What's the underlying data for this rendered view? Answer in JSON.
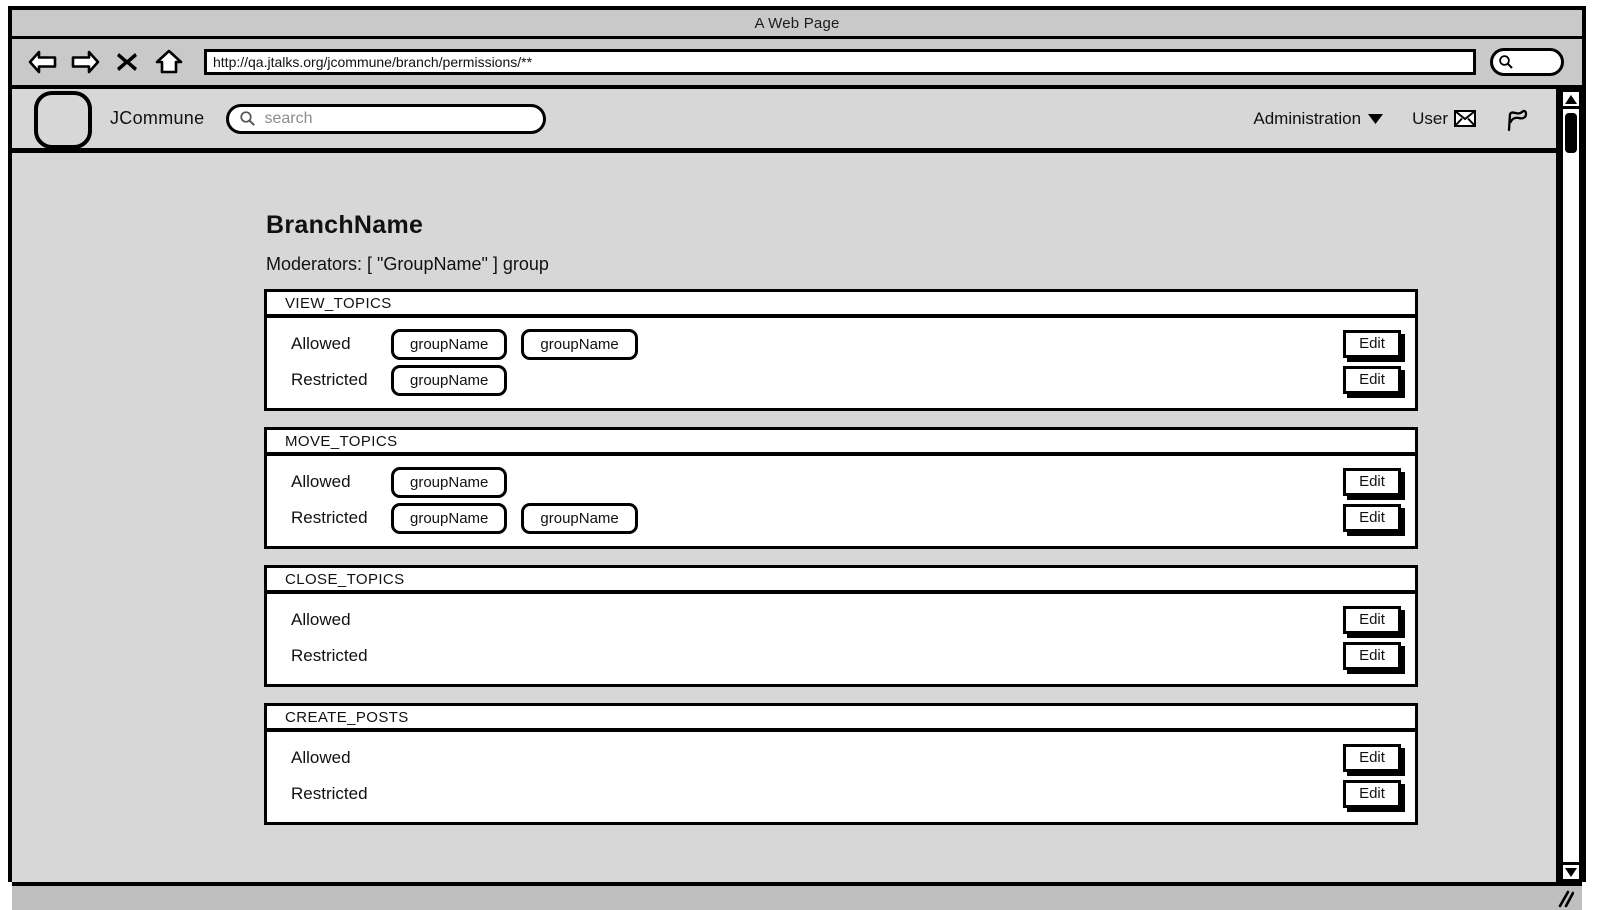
{
  "window": {
    "title": "A Web Page",
    "back_icon": "back-arrow-icon",
    "forward_icon": "forward-arrow-icon",
    "stop_icon": "close-x-icon",
    "home_icon": "home-icon",
    "url": "http://qa.jtalks.org/jcommune/branch/permissions/**",
    "toolbar_search_icon": "search-icon",
    "toolbar_search_value": ""
  },
  "site_header": {
    "logo": "logo-placeholder",
    "brand": "JCommune",
    "search": {
      "icon": "search-icon",
      "placeholder": "search",
      "value": ""
    },
    "administration_label": "Administration",
    "administration_caret": "chevron-down-icon",
    "user_label": "User",
    "user_icon": "envelope-icon",
    "flag_icon": "flag-icon"
  },
  "page": {
    "branch_name": "BranchName",
    "moderators_line": "Moderators: [ \"GroupName\" ] group",
    "row_labels": {
      "allowed": "Allowed",
      "restricted": "Restricted"
    },
    "edit_label": "Edit",
    "permissions": [
      {
        "name": "VIEW_TOPICS",
        "allowed": [
          "groupName",
          "groupName"
        ],
        "restricted": [
          "groupName"
        ]
      },
      {
        "name": "MOVE_TOPICS",
        "allowed": [
          "groupName"
        ],
        "restricted": [
          "groupName",
          "groupName"
        ]
      },
      {
        "name": "CLOSE_TOPICS",
        "allowed": [],
        "restricted": []
      },
      {
        "name": "CREATE_POSTS",
        "allowed": [],
        "restricted": []
      }
    ]
  },
  "scrollbar": {
    "up_icon": "triangle-up-icon",
    "down_icon": "triangle-down-icon"
  },
  "status_bar": {
    "resize_grip_icon": "resize-grip-icon"
  },
  "colors": {
    "chrome": "#c9c9c9",
    "page_bg": "#d7d7d7",
    "panel_bg": "#ffffff",
    "ink": "#000000",
    "status_bar": "#bfbfbf",
    "placeholder": "#8d8d8d"
  }
}
